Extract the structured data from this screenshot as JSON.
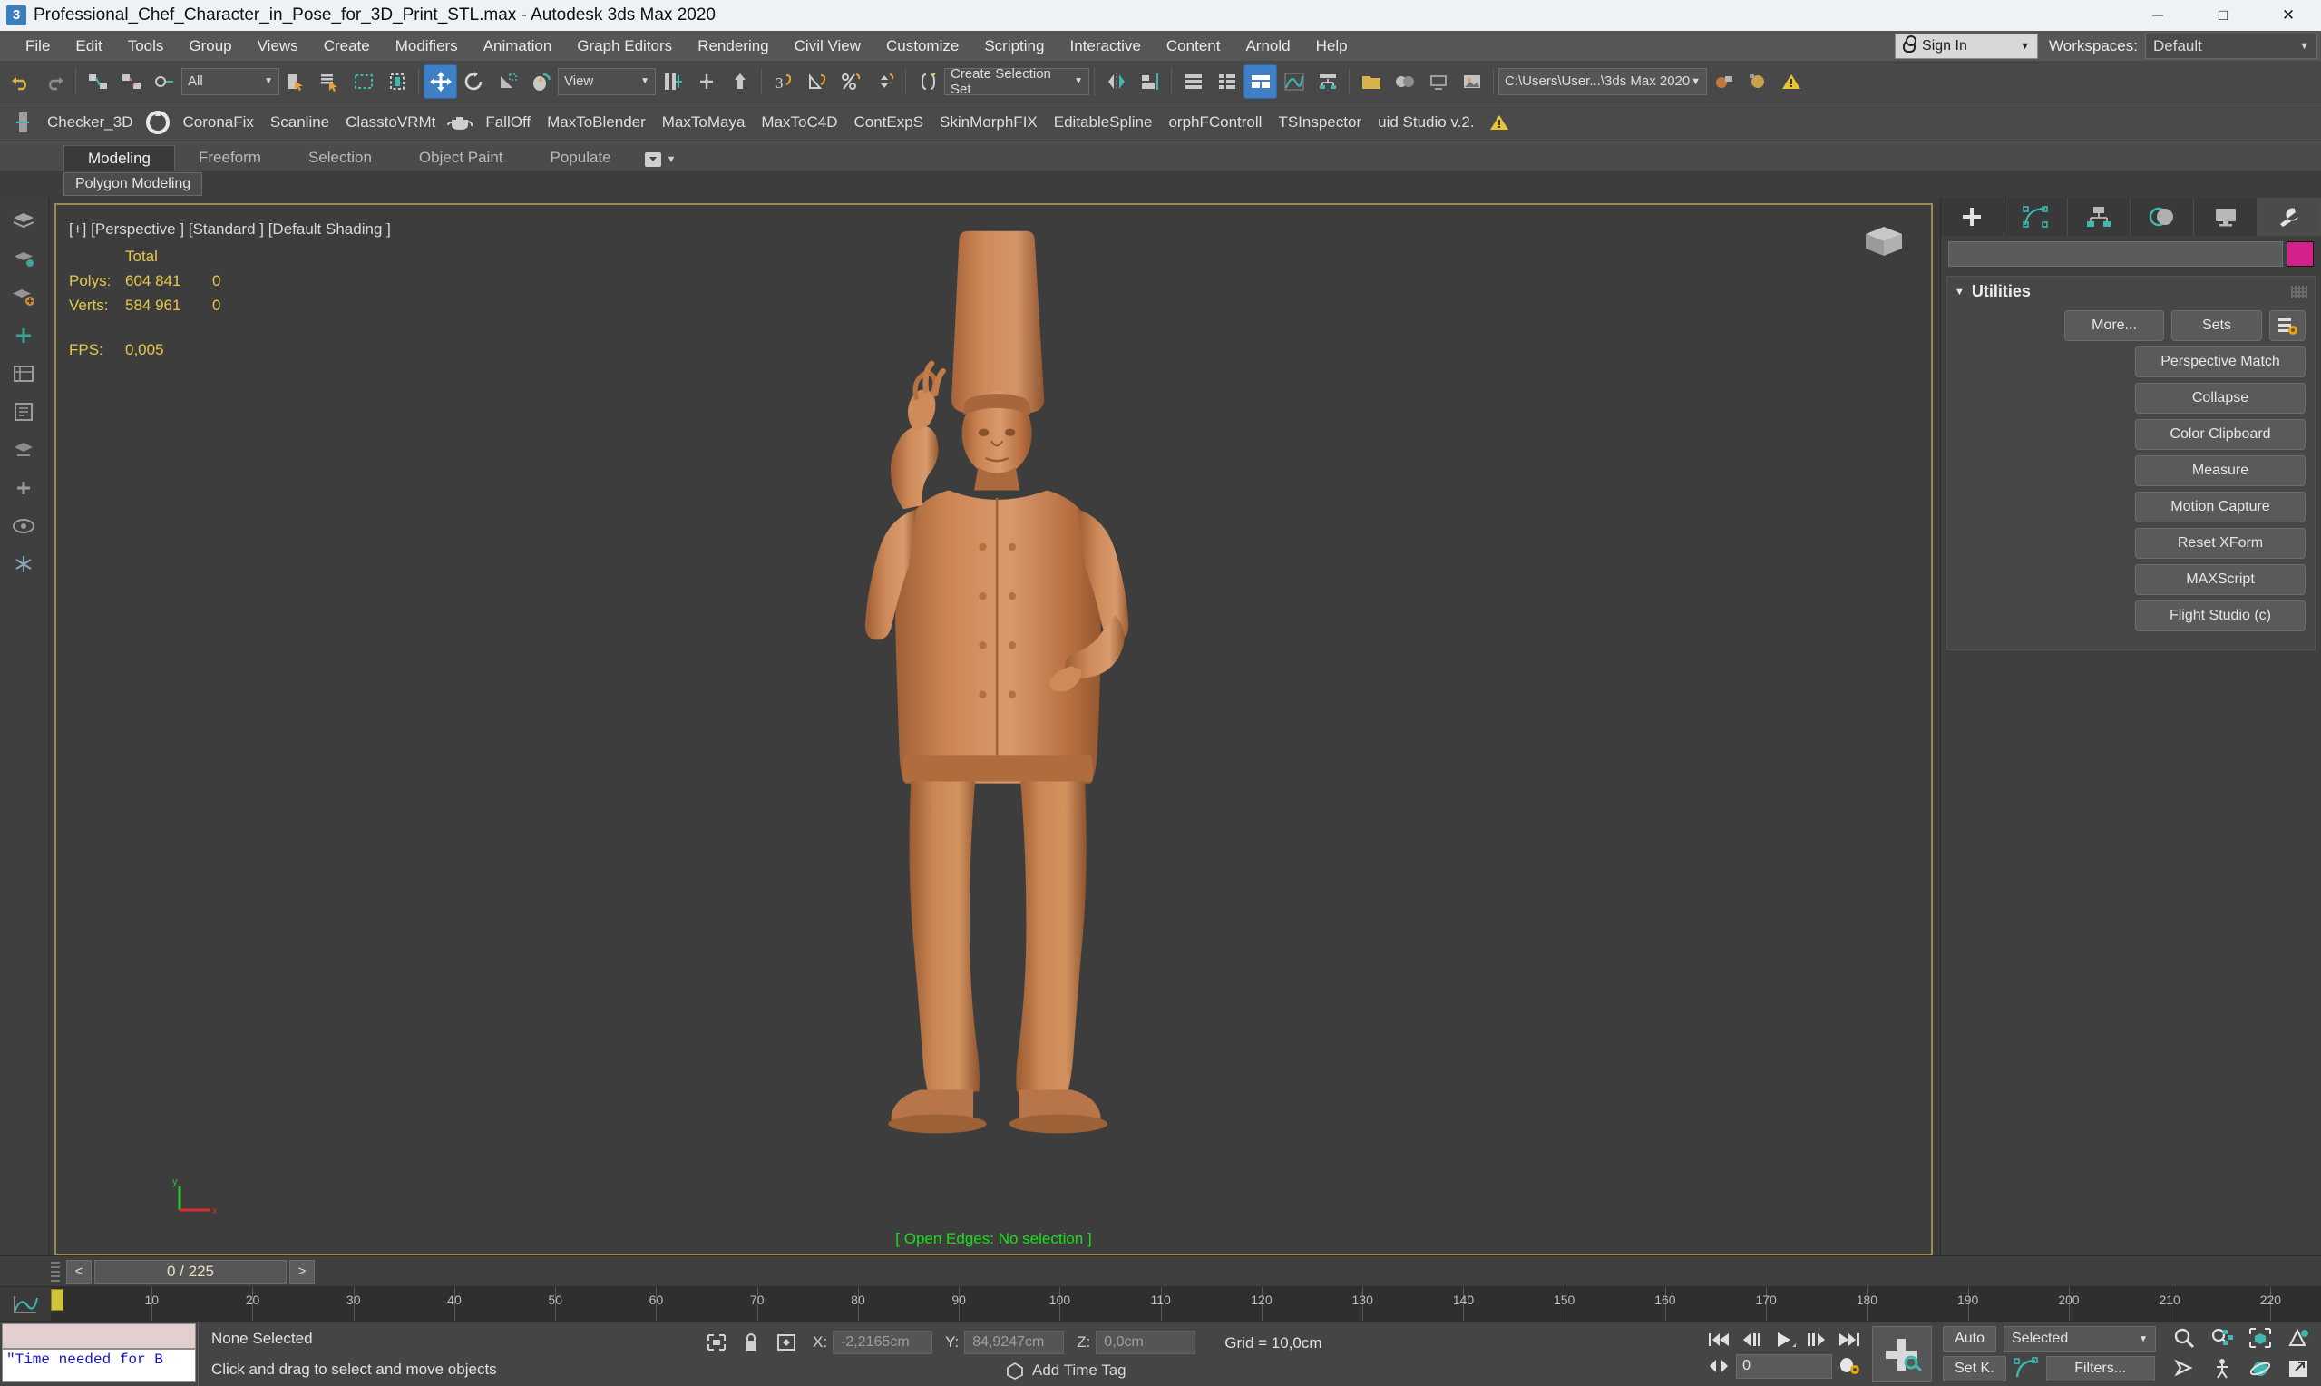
{
  "window": {
    "title": "Professional_Chef_Character_in_Pose_for_3D_Print_STL.max - Autodesk 3ds Max 2020",
    "app_icon": "3dsmax-icon",
    "minimize": "─",
    "maximize": "□",
    "close": "✕"
  },
  "menubar": {
    "items": [
      "File",
      "Edit",
      "Tools",
      "Group",
      "Views",
      "Create",
      "Modifiers",
      "Animation",
      "Graph Editors",
      "Rendering",
      "Civil View",
      "Customize",
      "Scripting",
      "Interactive",
      "Content",
      "Arnold",
      "Help"
    ],
    "sign_in": "Sign In",
    "workspaces_label": "Workspaces:",
    "workspace_value": "Default",
    "caret": "▼"
  },
  "main_toolbar": {
    "selection_filter": "All",
    "reference_coord": "View",
    "selection_set_placeholder": "Create Selection Set",
    "project_path": "C:\\Users\\User...\\3ds Max 2020",
    "caret": "▼",
    "icons": [
      "undo-icon",
      "redo-icon",
      "select-link-icon",
      "unlink-icon",
      "bind-space-warp-icon",
      "selection-filter-dropdown",
      "select-object-icon",
      "select-by-name-icon",
      "rectangular-region-icon",
      "window-crossing-icon",
      "select-and-move-icon",
      "select-and-rotate-icon",
      "select-and-scale-icon",
      "select-and-place-icon",
      "reference-coordinate-dropdown",
      "use-pivot-center-icon",
      "select-and-manipulate-icon",
      "snaps-toggle-icon",
      "angle-snap-icon",
      "percent-snap-icon",
      "spinner-snap-icon",
      "edit-named-selection-icon",
      "mirror-icon",
      "align-icon",
      "layer-explorer-icon",
      "scene-explorer-icon",
      "ribbon-toggle-icon",
      "curve-editor-icon",
      "schematic-view-icon",
      "material-editor-icon",
      "render-setup-icon",
      "render-frame-icon",
      "render-production-icon",
      "render-iterative-icon",
      "project-folder-icon",
      "warning-icon"
    ]
  },
  "plugin_toolbar": {
    "items": [
      "Checker_3D",
      "CoronaFix",
      "Scanline",
      "ClasstoVRMt",
      "FallOff",
      "MaxToBlender",
      "MaxToMaya",
      "MaxToC4D",
      "ContExpS",
      "SkinMorphFIX",
      "EditableSpline",
      "orphFControll",
      "TSInspector",
      "uid Studio v.2."
    ],
    "warning": "⚠"
  },
  "ribbon": {
    "tabs": [
      "Modeling",
      "Freeform",
      "Selection",
      "Object Paint",
      "Populate"
    ],
    "active_tab": "Modeling",
    "panel_label": "Polygon Modeling",
    "overflow_caret": "▼"
  },
  "viewport": {
    "label": "[+] [Perspective ] [Standard ] [Default Shading ]",
    "stats": {
      "col_header": "Total",
      "rows": [
        {
          "label": "Polys:",
          "total": "604 841",
          "selected": "0"
        },
        {
          "label": "Verts:",
          "total": "584 961",
          "selected": "0"
        }
      ],
      "fps_label": "FPS:",
      "fps_value": "0,005"
    },
    "open_edges": "[ Open Edges: No selection ]",
    "axis_x": "x",
    "axis_y": "y",
    "model_colors": {
      "base": "#c67d4e",
      "shade": "#a2613a",
      "light": "#d99a6c"
    }
  },
  "command_panel": {
    "tabs": [
      "create-tab",
      "modify-tab",
      "hierarchy-tab",
      "motion-tab",
      "display-tab",
      "utilities-tab"
    ],
    "active_tab": "utilities-tab",
    "name_field_value": "",
    "color_swatch": "#d3208b",
    "rollout": {
      "title": "Utilities",
      "collapse_caret": "▼",
      "more_button": "More...",
      "sets_button": "Sets",
      "config_button": "configure-button-sets-icon",
      "buttons": [
        "Perspective Match",
        "Collapse",
        "Color Clipboard",
        "Measure",
        "Motion Capture",
        "Reset XForm",
        "MAXScript",
        "Flight Studio (c)"
      ]
    }
  },
  "timeline": {
    "prev_label": "<",
    "frame_display": "0 / 225",
    "next_label": ">"
  },
  "trackbar": {
    "ticks": [
      10,
      20,
      30,
      40,
      50,
      60,
      70,
      80,
      90,
      100,
      110,
      120,
      130,
      140,
      150,
      160,
      170,
      180,
      190,
      200,
      210,
      220
    ],
    "current_frame": 0,
    "max_frame": 225
  },
  "statusbar": {
    "maxscript_listener_value": "\"Time needed for B",
    "selection_status": "None Selected",
    "prompt": "Click and drag to select and move objects",
    "coords": [
      {
        "axis": "X:",
        "value": "-2,2165cm"
      },
      {
        "axis": "Y:",
        "value": "84,9247cm"
      },
      {
        "axis": "Z:",
        "value": "0,0cm"
      }
    ],
    "grid": "Grid = 10,0cm",
    "add_time_tag": "Add Time Tag",
    "auto_key": "Auto",
    "set_key": "Set K.",
    "key_filter_selected": "Selected",
    "filters_button": "Filters...",
    "frame_spinner_value": "0",
    "caret": "▼",
    "nav_icons": [
      "zoom-icon",
      "zoom-all-icon",
      "zoom-extents-icon",
      "field-of-view-icon",
      "pan-icon",
      "walkthrough-icon",
      "orbit-icon",
      "maximize-viewport-icon"
    ]
  }
}
